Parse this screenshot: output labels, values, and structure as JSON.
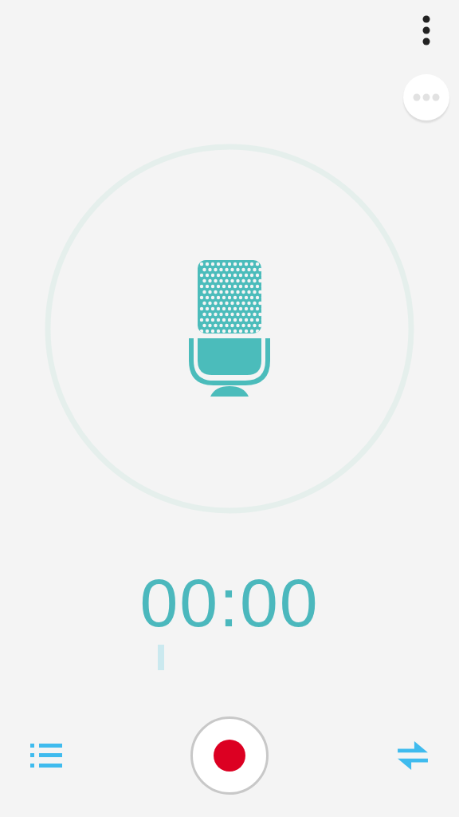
{
  "timer": "00:00"
}
